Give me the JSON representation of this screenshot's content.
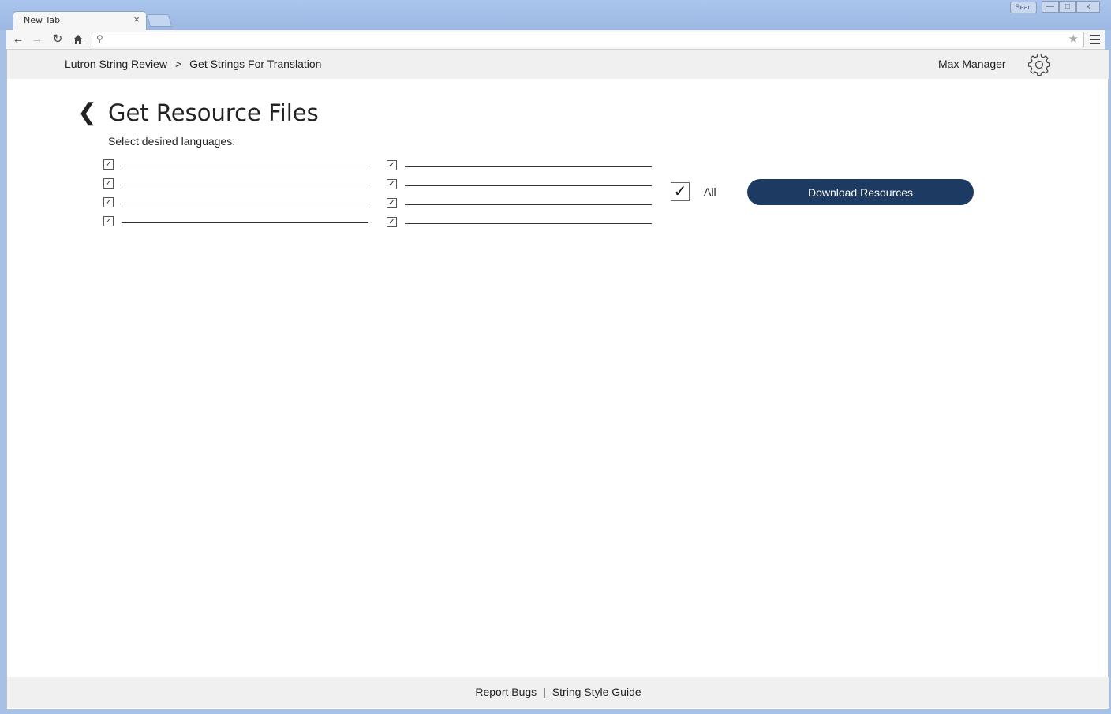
{
  "browser": {
    "tab_title": "New Tab",
    "tab_close": "×",
    "user_badge": "Sean",
    "omnibox_value": "",
    "controls": {
      "minimize": "—",
      "maximize": "□",
      "close": "x"
    }
  },
  "header": {
    "breadcrumb": [
      "Lutron String Review",
      ">",
      "Get Strings For Translation"
    ],
    "user_name": "Max Manager"
  },
  "main": {
    "back_symbol": "❮",
    "title": "Get Resource Files",
    "select_label": "Select desired languages:",
    "languages_left": [
      {
        "checked": true,
        "label": ""
      },
      {
        "checked": true,
        "label": ""
      },
      {
        "checked": true,
        "label": ""
      },
      {
        "checked": true,
        "label": ""
      }
    ],
    "languages_right": [
      {
        "checked": true,
        "label": ""
      },
      {
        "checked": true,
        "label": ""
      },
      {
        "checked": true,
        "label": ""
      },
      {
        "checked": true,
        "label": ""
      }
    ],
    "all_checked": true,
    "all_label": "All",
    "download_label": "Download Resources"
  },
  "footer": {
    "report_bugs": "Report Bugs",
    "separator": "|",
    "style_guide": "String Style Guide"
  },
  "colors": {
    "accent": "#1d3a63",
    "header_bg": "#f0f0f0",
    "window_frame": "#a6c0e6"
  }
}
